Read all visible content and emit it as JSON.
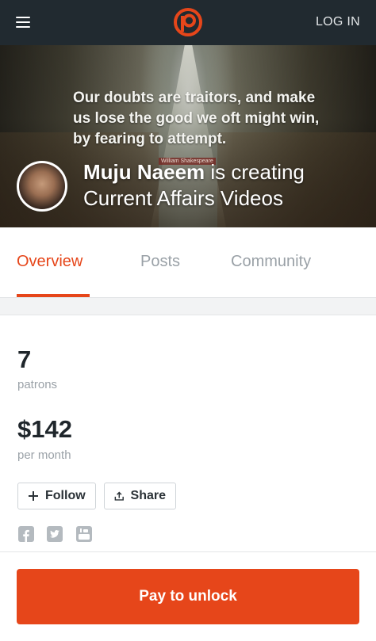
{
  "header": {
    "login_label": "LOG IN",
    "brand_color": "#e6461a",
    "bg_color": "#212a30"
  },
  "hero": {
    "quote": "Our doubts are traitors, and make us lose the good we oft might win, by fearing to attempt.",
    "quote_attribution": "William Shakespeare",
    "creator_name": "Muju Naeem",
    "creating_text": "is creating",
    "creation_title": "Current Affairs Videos"
  },
  "tabs": [
    {
      "label": "Overview",
      "active": true
    },
    {
      "label": "Posts",
      "active": false
    },
    {
      "label": "Community",
      "active": false
    }
  ],
  "stats": {
    "patrons_value": "7",
    "patrons_label": "patrons",
    "earnings_value": "$142",
    "earnings_label": "per month"
  },
  "actions": {
    "follow_label": "Follow",
    "share_label": "Share"
  },
  "social": [
    "facebook-icon",
    "twitter-icon",
    "youtube-icon"
  ],
  "footer": {
    "pay_label": "Pay to unlock"
  }
}
